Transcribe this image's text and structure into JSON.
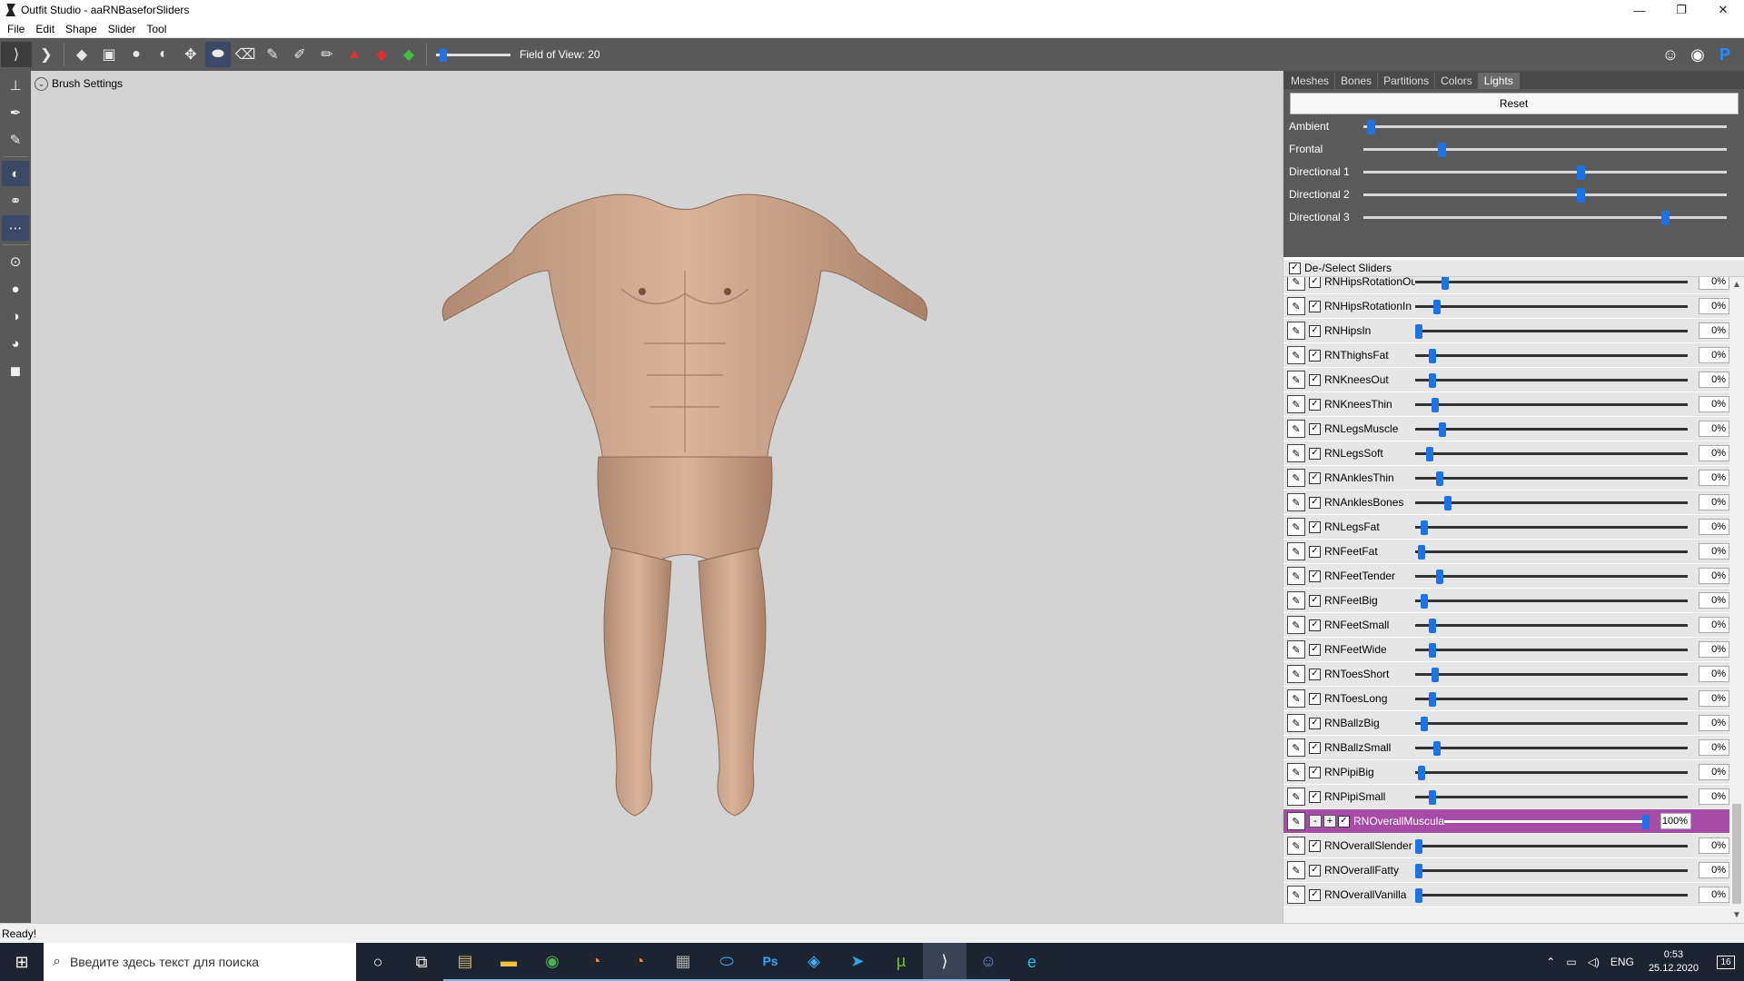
{
  "window": {
    "title": "Outfit Studio - aaRNBaseforSliders",
    "controls": [
      "—",
      "❐",
      "✕"
    ]
  },
  "menu": [
    "File",
    "Edit",
    "Shape",
    "Slider",
    "Tool"
  ],
  "toolbar": {
    "fov_label": "Field of View: 20",
    "fov_level": 0.06
  },
  "viewport": {
    "brush_settings_label": "Brush Settings"
  },
  "right_panel": {
    "tabs": [
      "Meshes",
      "Bones",
      "Partitions",
      "Colors",
      "Lights"
    ],
    "active_tab": "Lights",
    "lights": {
      "reset_label": "Reset",
      "items": [
        {
          "label": "Ambient",
          "level": 0.01
        },
        {
          "label": "Frontal",
          "level": 0.21
        },
        {
          "label": "Directional 1",
          "level": 0.6
        },
        {
          "label": "Directional 2",
          "level": 0.6
        },
        {
          "label": "Directional 3",
          "level": 0.84
        }
      ]
    },
    "deselect_label": "De-/Select Sliders",
    "sliders": [
      {
        "name": "RNHipsRotationOut",
        "value": "0%",
        "level": 0.1
      },
      {
        "name": "RNHipsRotationIn",
        "value": "0%",
        "level": 0.07
      },
      {
        "name": "RNHipsIn",
        "value": "0%",
        "level": 0.0
      },
      {
        "name": "RNThighsFat",
        "value": "0%",
        "level": 0.05
      },
      {
        "name": "RNKneesOut",
        "value": "0%",
        "level": 0.05
      },
      {
        "name": "RNKneesThin",
        "value": "0%",
        "level": 0.06
      },
      {
        "name": "RNLegsMuscle",
        "value": "0%",
        "level": 0.09
      },
      {
        "name": "RNLegsSoft",
        "value": "0%",
        "level": 0.04
      },
      {
        "name": "RNAnklesThin",
        "value": "0%",
        "level": 0.08
      },
      {
        "name": "RNAnklesBones",
        "value": "0%",
        "level": 0.11
      },
      {
        "name": "RNLegsFat",
        "value": "0%",
        "level": 0.02
      },
      {
        "name": "RNFeetFat",
        "value": "0%",
        "level": 0.01
      },
      {
        "name": "RNFeetTender",
        "value": "0%",
        "level": 0.08
      },
      {
        "name": "RNFeetBig",
        "value": "0%",
        "level": 0.02
      },
      {
        "name": "RNFeetSmall",
        "value": "0%",
        "level": 0.05
      },
      {
        "name": "RNFeetWide",
        "value": "0%",
        "level": 0.05
      },
      {
        "name": "RNToesShort",
        "value": "0%",
        "level": 0.06
      },
      {
        "name": "RNToesLong",
        "value": "0%",
        "level": 0.05
      },
      {
        "name": "RNBallzBig",
        "value": "0%",
        "level": 0.02
      },
      {
        "name": "RNBallzSmall",
        "value": "0%",
        "level": 0.07
      },
      {
        "name": "RNPipiBig",
        "value": "0%",
        "level": 0.01
      },
      {
        "name": "RNPipiSmall",
        "value": "0%",
        "level": 0.05
      },
      {
        "name": "RNOverallMuscular",
        "value": "100%",
        "level": 1.0,
        "highlight": true
      },
      {
        "name": "RNOverallSlender",
        "value": "0%",
        "level": 0.0
      },
      {
        "name": "RNOverallFatty",
        "value": "0%",
        "level": 0.0
      },
      {
        "name": "RNOverallVanilla",
        "value": "0%",
        "level": 0.0
      }
    ]
  },
  "status": "Ready!",
  "taskbar": {
    "search_placeholder": "Введите здесь текст для поиска",
    "lang": "ENG",
    "time": "0:53",
    "date": "25.12.2020",
    "notifications": "16"
  },
  "colors": {
    "accent": "#1a73e8",
    "highlight_row": "#a64ca6",
    "toolbar_bg": "#595959",
    "viewport_bg": "#d3d3d3"
  }
}
